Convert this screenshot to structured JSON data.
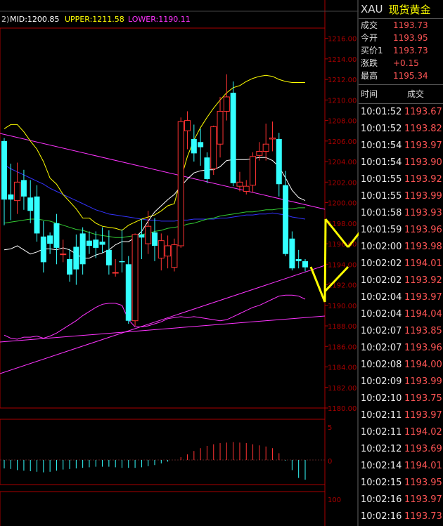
{
  "header": {
    "prefix": "2)",
    "mid": "MID:1200.85",
    "upper": "UPPER:1211.58",
    "lower": "LOWER:1190.11"
  },
  "quote": {
    "symbol": "XAU",
    "name": "现货黄金",
    "rows": [
      {
        "label": "成交",
        "value": "1193.73"
      },
      {
        "label": "今开",
        "value": "1193.95"
      },
      {
        "label": "买价1",
        "value": "1193.73"
      },
      {
        "label": "涨跌",
        "value": "+0.15"
      },
      {
        "label": "最高",
        "value": "1195.34"
      }
    ],
    "tick_header": {
      "time": "时间",
      "price": "成交"
    },
    "ticks": [
      {
        "time": "10:01:52",
        "price": "1193.67"
      },
      {
        "time": "10:01:52",
        "price": "1193.82"
      },
      {
        "time": "10:01:54",
        "price": "1193.97"
      },
      {
        "time": "10:01:54",
        "price": "1193.90"
      },
      {
        "time": "10:01:55",
        "price": "1193.92"
      },
      {
        "time": "10:01:55",
        "price": "1193.99"
      },
      {
        "time": "10:01:58",
        "price": "1193.93"
      },
      {
        "time": "10:01:59",
        "price": "1193.96"
      },
      {
        "time": "10:02:00",
        "price": "1193.98"
      },
      {
        "time": "10:02:02",
        "price": "1194.01"
      },
      {
        "time": "10:02:02",
        "price": "1193.92"
      },
      {
        "time": "10:02:04",
        "price": "1193.97"
      },
      {
        "time": "10:02:04",
        "price": "1194.04"
      },
      {
        "time": "10:02:07",
        "price": "1193.85"
      },
      {
        "time": "10:02:07",
        "price": "1193.96"
      },
      {
        "time": "10:02:08",
        "price": "1194.00"
      },
      {
        "time": "10:02:09",
        "price": "1193.99"
      },
      {
        "time": "10:02:10",
        "price": "1193.75"
      },
      {
        "time": "10:02:11",
        "price": "1193.97"
      },
      {
        "time": "10:02:11",
        "price": "1194.02"
      },
      {
        "time": "10:02:12",
        "price": "1193.69"
      },
      {
        "time": "10:02:14",
        "price": "1194.01"
      },
      {
        "time": "10:02:15",
        "price": "1193.95"
      },
      {
        "time": "10:02:16",
        "price": "1193.97"
      },
      {
        "time": "10:02:16",
        "price": "1193.73"
      }
    ]
  },
  "colors": {
    "up": "#ff3333",
    "down": "#33ffff",
    "mid_line": "#ffffff",
    "upper_line": "#ffff00",
    "lower_line": "#ff33ff",
    "ma_blue": "#3333ff",
    "ma_green": "#33cc33",
    "arrow": "#ffff00",
    "grid": "#aa0000"
  },
  "chart_data": {
    "type": "candlestick",
    "ylim": [
      1180,
      1217
    ],
    "y_ticks": [
      "1216.00",
      "1214.00",
      "1212.00",
      "1210.00",
      "1208.00",
      "1206.00",
      "1204.00",
      "1202.00",
      "1200.00",
      "1198.00",
      "1196.00",
      "1194.00",
      "1192.00",
      "1190.00",
      "1188.00",
      "1186.00",
      "1184.00",
      "1182.00",
      "1180.00"
    ],
    "candles": [
      {
        "o": 1206.0,
        "h": 1206.3,
        "c": 1200.3,
        "l": 1197.8
      },
      {
        "o": 1200.8,
        "h": 1203.8,
        "c": 1200.3,
        "l": 1198.3
      },
      {
        "o": 1200.2,
        "h": 1203.9,
        "c": 1202.0,
        "l": 1198.9
      },
      {
        "o": 1202.2,
        "h": 1203.2,
        "c": 1200.6,
        "l": 1199.3
      },
      {
        "o": 1200.5,
        "h": 1202.2,
        "c": 1199.2,
        "l": 1198.0
      },
      {
        "o": 1200.6,
        "h": 1201.7,
        "c": 1197.0,
        "l": 1196.2
      },
      {
        "o": 1196.7,
        "h": 1198.2,
        "c": 1194.2,
        "l": 1193.2
      },
      {
        "o": 1196.8,
        "h": 1197.1,
        "c": 1196.0,
        "l": 1195.0
      },
      {
        "o": 1198.0,
        "h": 1198.9,
        "c": 1195.6,
        "l": 1194.0
      },
      {
        "o": 1195.0,
        "h": 1196.4,
        "c": 1195.0,
        "l": 1194.2
      },
      {
        "o": 1194.5,
        "h": 1195.5,
        "c": 1193.0,
        "l": 1192.3
      },
      {
        "o": 1195.7,
        "h": 1196.9,
        "c": 1193.5,
        "l": 1192.0
      },
      {
        "o": 1197.0,
        "h": 1197.6,
        "c": 1194.0,
        "l": 1193.0
      },
      {
        "o": 1196.3,
        "h": 1197.2,
        "c": 1195.8,
        "l": 1195.0
      },
      {
        "o": 1196.4,
        "h": 1197.2,
        "c": 1195.6,
        "l": 1194.6
      },
      {
        "o": 1196.2,
        "h": 1197.6,
        "c": 1195.9,
        "l": 1195.1
      },
      {
        "o": 1195.4,
        "h": 1197.3,
        "c": 1193.9,
        "l": 1193.0
      },
      {
        "o": 1193.2,
        "h": 1194.5,
        "c": 1193.2,
        "l": 1192.8
      },
      {
        "o": 1194.3,
        "h": 1197.4,
        "c": 1194.2,
        "l": 1193.2
      },
      {
        "o": 1194.0,
        "h": 1194.8,
        "c": 1188.5,
        "l": 1188.2
      },
      {
        "o": 1188.5,
        "h": 1197.0,
        "c": 1196.9,
        "l": 1188.0
      },
      {
        "o": 1196.9,
        "h": 1198.4,
        "c": 1196.6,
        "l": 1194.5
      },
      {
        "o": 1196.0,
        "h": 1199.2,
        "c": 1197.7,
        "l": 1195.0
      },
      {
        "o": 1197.1,
        "h": 1198.5,
        "c": 1195.8,
        "l": 1194.3
      },
      {
        "o": 1194.6,
        "h": 1197.0,
        "c": 1196.3,
        "l": 1193.4
      },
      {
        "o": 1194.8,
        "h": 1196.8,
        "c": 1195.8,
        "l": 1193.6
      },
      {
        "o": 1193.7,
        "h": 1196.5,
        "c": 1195.9,
        "l": 1193.3
      },
      {
        "o": 1195.8,
        "h": 1208.3,
        "c": 1207.9,
        "l": 1195.6
      },
      {
        "o": 1207.0,
        "h": 1208.9,
        "c": 1208.0,
        "l": 1205.2
      },
      {
        "o": 1206.2,
        "h": 1207.6,
        "c": 1204.8,
        "l": 1204.0
      },
      {
        "o": 1205.9,
        "h": 1207.2,
        "c": 1205.4,
        "l": 1203.6
      },
      {
        "o": 1204.4,
        "h": 1204.9,
        "c": 1202.3,
        "l": 1201.9
      },
      {
        "o": 1203.3,
        "h": 1207.5,
        "c": 1207.4,
        "l": 1202.7
      },
      {
        "o": 1205.7,
        "h": 1210.3,
        "c": 1208.9,
        "l": 1204.4
      },
      {
        "o": 1208.9,
        "h": 1212.5,
        "c": 1210.3,
        "l": 1208.0
      },
      {
        "o": 1210.7,
        "h": 1211.8,
        "c": 1201.9,
        "l": 1201.6
      },
      {
        "o": 1201.6,
        "h": 1203.0,
        "c": 1202.0,
        "l": 1201.1
      },
      {
        "o": 1201.1,
        "h": 1202.2,
        "c": 1201.6,
        "l": 1200.8
      },
      {
        "o": 1201.7,
        "h": 1204.9,
        "c": 1204.5,
        "l": 1201.0
      },
      {
        "o": 1204.6,
        "h": 1205.9,
        "c": 1205.0,
        "l": 1204.1
      },
      {
        "o": 1205.0,
        "h": 1207.7,
        "c": 1205.7,
        "l": 1204.1
      },
      {
        "o": 1206.2,
        "h": 1207.9,
        "c": 1206.3,
        "l": 1205.0
      },
      {
        "o": 1206.2,
        "h": 1206.8,
        "c": 1201.8,
        "l": 1200.6
      },
      {
        "o": 1201.7,
        "h": 1203.1,
        "c": 1195.0,
        "l": 1194.8
      },
      {
        "o": 1196.5,
        "h": 1197.2,
        "c": 1193.6,
        "l": 1193.4
      },
      {
        "o": 1194.5,
        "h": 1195.4,
        "c": 1194.3,
        "l": 1193.6
      },
      {
        "o": 1194.3,
        "h": 1194.5,
        "c": 1193.7,
        "l": 1193.3
      }
    ],
    "upper_band": [
      1207.2,
      1207.6,
      1207.6,
      1206.9,
      1206.0,
      1205.2,
      1204.0,
      1202.4,
      1201.8,
      1200.8,
      1200.1,
      1199.4,
      1198.5,
      1198.5,
      1198.0,
      1197.7,
      1197.6,
      1197.5,
      1197.3,
      1197.8,
      1198.1,
      1198.4,
      1198.6,
      1198.8,
      1199.2,
      1199.7,
      1199.9,
      1202.3,
      1204.5,
      1206.1,
      1207.3,
      1208.3,
      1209.2,
      1210.0,
      1210.7,
      1211.2,
      1211.4,
      1211.8,
      1212.1,
      1212.3,
      1212.4,
      1212.3,
      1212.0,
      1211.8,
      1211.7,
      1211.7,
      1211.7
    ],
    "lower_band": [
      1187.1,
      1186.8,
      1186.7,
      1186.9,
      1186.9,
      1187.0,
      1186.8,
      1187.0,
      1187.3,
      1187.7,
      1188.1,
      1188.5,
      1189.0,
      1189.4,
      1189.8,
      1190.1,
      1190.2,
      1190.2,
      1190.0,
      1188.6,
      1187.9,
      1187.9,
      1188.0,
      1188.2,
      1188.4,
      1188.7,
      1188.8,
      1188.9,
      1188.8,
      1188.9,
      1188.8,
      1188.7,
      1188.6,
      1188.5,
      1188.6,
      1188.9,
      1189.2,
      1189.5,
      1189.8,
      1190.0,
      1190.3,
      1190.6,
      1190.9,
      1191.0,
      1191.0,
      1190.9,
      1190.6
    ],
    "mid_band": [
      1195.4,
      1195.5,
      1195.8,
      1195.4,
      1195.0,
      1195.2,
      1195.5,
      1195.5,
      1195.4,
      1195.6,
      1195.4,
      1195.0,
      1194.6,
      1194.6,
      1194.9,
      1195.1,
      1195.4,
      1195.9,
      1196.2,
      1196.2,
      1196.6,
      1197.2,
      1198.2,
      1199.1,
      1199.7,
      1200.3,
      1200.8,
      1201.6,
      1202.3,
      1202.9,
      1203.1,
      1203.2,
      1203.2,
      1203.5,
      1204.1,
      1204.2,
      1204.2,
      1204.2,
      1204.3,
      1204.4,
      1204.4,
      1204.1,
      1203.5,
      1202.4,
      1201.2,
      1200.5,
      1200.2
    ],
    "ma_blue": [
      1203.7,
      1203.3,
      1203.0,
      1202.7,
      1202.4,
      1202.1,
      1201.8,
      1201.4,
      1201.1,
      1200.8,
      1200.5,
      1200.2,
      1199.9,
      1199.6,
      1199.3,
      1199.1,
      1198.9,
      1198.8,
      1198.7,
      1198.6,
      1198.5,
      1198.4,
      1198.3,
      1198.3,
      1198.2,
      1198.2,
      1198.2,
      1198.3,
      1198.3,
      1198.4,
      1198.4,
      1198.4,
      1198.4,
      1198.5,
      1198.5,
      1198.6,
      1198.7,
      1198.8,
      1198.8,
      1198.9,
      1198.9,
      1199.0,
      1198.9,
      1198.8,
      1198.6,
      1198.5,
      1198.4
    ],
    "ma_green": [
      1198.0,
      1198.1,
      1198.2,
      1198.3,
      1198.4,
      1198.4,
      1198.3,
      1198.2,
      1198.0,
      1197.8,
      1197.6,
      1197.4,
      1197.3,
      1197.1,
      1196.9,
      1196.8,
      1196.7,
      1196.6,
      1196.6,
      1196.7,
      1196.8,
      1196.9,
      1197.0,
      1197.2,
      1197.3,
      1197.5,
      1197.6,
      1197.7,
      1197.9,
      1198.0,
      1198.2,
      1198.4,
      1198.5,
      1198.7,
      1198.8,
      1198.9,
      1199.0,
      1199.1,
      1199.1,
      1199.2,
      1199.3,
      1199.3,
      1199.4,
      1199.4,
      1199.4,
      1199.5,
      1199.5
    ],
    "macd_hist": [
      -1.5,
      -1.6,
      -1.8,
      -1.9,
      -2.0,
      -2.1,
      -2.2,
      -2.1,
      -1.9,
      -1.7,
      -1.6,
      -1.5,
      -1.4,
      -1.3,
      -1.2,
      -1.2,
      -1.2,
      -1.3,
      -1.4,
      -1.4,
      -1.4,
      -1.3,
      -1.1,
      -0.9,
      -0.6,
      -0.3,
      0.0,
      0.5,
      1.0,
      1.6,
      2.1,
      2.5,
      2.8,
      3.0,
      3.1,
      3.2,
      3.1,
      3.0,
      2.8,
      2.6,
      2.4,
      2.1,
      1.2,
      -0.1,
      -1.8,
      -3.2,
      -3.5
    ]
  }
}
